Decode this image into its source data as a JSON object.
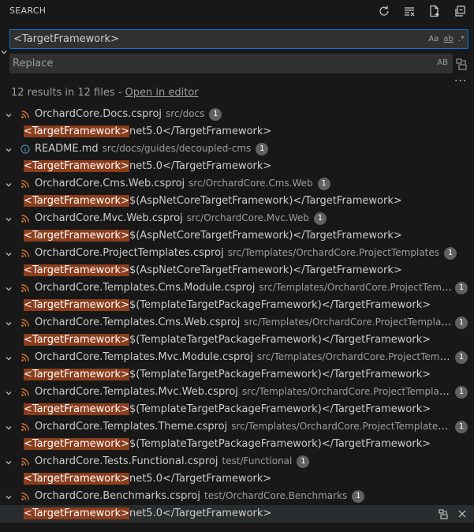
{
  "panel": {
    "title": "SEARCH"
  },
  "header_icons": [
    "refresh-icon",
    "clear-results-icon",
    "new-search-editor-icon",
    "collapse-all-icon"
  ],
  "search": {
    "value": "<TargetFramework>",
    "options": {
      "match_case": "Aa",
      "whole_word": "ab",
      "regex": ".*"
    }
  },
  "replace": {
    "placeholder": "Replace",
    "preserve_case": "AB"
  },
  "summary": {
    "text": "12 results in 12 files - ",
    "link": "Open in editor"
  },
  "results": [
    {
      "file": "OrchardCore.Docs.csproj",
      "path": "src/docs",
      "count": "1",
      "icon": "rss-icon",
      "match": "<TargetFramework>",
      "rest": "net5.0</TargetFramework>"
    },
    {
      "file": "README.md",
      "path": "src/docs/guides/decoupled-cms",
      "count": "1",
      "icon": "info-icon",
      "match": "<TargetFramework>",
      "rest": "net5.0</TargetFramework>"
    },
    {
      "file": "OrchardCore.Cms.Web.csproj",
      "path": "src/OrchardCore.Cms.Web",
      "count": "1",
      "icon": "rss-icon",
      "match": "<TargetFramework>",
      "rest": "$(AspNetCoreTargetFramework)</TargetFramework>"
    },
    {
      "file": "OrchardCore.Mvc.Web.csproj",
      "path": "src/OrchardCore.Mvc.Web",
      "count": "1",
      "icon": "rss-icon",
      "match": "<TargetFramework>",
      "rest": "$(AspNetCoreTargetFramework)</TargetFramework>"
    },
    {
      "file": "OrchardCore.ProjectTemplates.csproj",
      "path": "src/Templates/OrchardCore.ProjectTemplates",
      "count": "1",
      "icon": "rss-icon",
      "match": "<TargetFramework>",
      "rest": "$(AspNetCoreTargetFramework)</TargetFramework>"
    },
    {
      "file": "OrchardCore.Templates.Cms.Module.csproj",
      "path": "src/Templates/OrchardCore.ProjectTemplat...",
      "count": "1",
      "icon": "rss-icon",
      "match": "<TargetFramework>",
      "rest": "$(TemplateTargetPackageFramework)</TargetFramework>"
    },
    {
      "file": "OrchardCore.Templates.Cms.Web.csproj",
      "path": "src/Templates/OrchardCore.ProjectTemplates/c...",
      "count": "1",
      "icon": "rss-icon",
      "match": "<TargetFramework>",
      "rest": "$(TemplateTargetPackageFramework)</TargetFramework>"
    },
    {
      "file": "OrchardCore.Templates.Mvc.Module.csproj",
      "path": "src/Templates/OrchardCore.ProjectTemplat...",
      "count": "1",
      "icon": "rss-icon",
      "match": "<TargetFramework>",
      "rest": "$(TemplateTargetPackageFramework)</TargetFramework>"
    },
    {
      "file": "OrchardCore.Templates.Mvc.Web.csproj",
      "path": "src/Templates/OrchardCore.ProjectTemplates/c...",
      "count": "1",
      "icon": "rss-icon",
      "match": "<TargetFramework>",
      "rest": "$(TemplateTargetPackageFramework)</TargetFramework>"
    },
    {
      "file": "OrchardCore.Templates.Theme.csproj",
      "path": "src/Templates/OrchardCore.ProjectTemplates/con...",
      "count": "1",
      "icon": "rss-icon",
      "match": "<TargetFramework>",
      "rest": "$(TemplateTargetPackageFramework)</TargetFramework>"
    },
    {
      "file": "OrchardCore.Tests.Functional.csproj",
      "path": "test/Functional",
      "count": "1",
      "icon": "rss-icon",
      "match": "<TargetFramework>",
      "rest": "net5.0</TargetFramework>"
    },
    {
      "file": "OrchardCore.Benchmarks.csproj",
      "path": "test/OrchardCore.Benchmarks",
      "count": "1",
      "icon": "rss-icon",
      "match": "<TargetFramework>",
      "rest": "net5.0</TargetFramework>"
    }
  ],
  "colors": {
    "accent": "#0078d4",
    "match_highlight": "#8b3d1c",
    "rss": "#e37933",
    "info": "#519aba"
  }
}
